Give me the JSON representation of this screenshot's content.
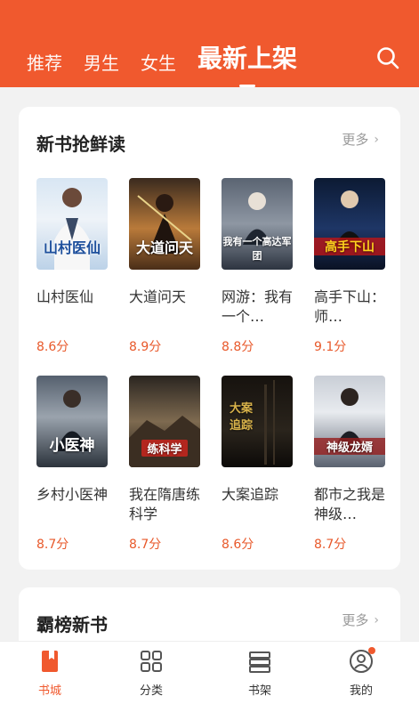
{
  "header": {
    "tabs": [
      {
        "label": "推荐"
      },
      {
        "label": "男生"
      },
      {
        "label": "女生"
      },
      {
        "label": "最新上架"
      }
    ],
    "active_tab": "最新上架",
    "search_icon": "search-icon",
    "bg_color": "#f0592e"
  },
  "section1": {
    "title": "新书抢鲜读",
    "more": "更多",
    "books": [
      {
        "title": "山村医仙",
        "score": "8.6分",
        "cover_text": "山村医仙"
      },
      {
        "title": "大道问天",
        "score": "8.9分",
        "cover_text": "大道问天"
      },
      {
        "title": "网游：我有一个…",
        "score": "8.8分",
        "cover_text": "我有一个高达军团"
      },
      {
        "title": "高手下山：师…",
        "score": "9.1分",
        "cover_text": "高手下山"
      },
      {
        "title": "乡村小医神",
        "score": "8.7分",
        "cover_text": "小医神"
      },
      {
        "title": "我在隋唐练科学",
        "score": "8.7分",
        "cover_text": "练科学"
      },
      {
        "title": "大案追踪",
        "score": "8.6分",
        "cover_text": "大案追踪"
      },
      {
        "title": "都市之我是神级…",
        "score": "8.7分",
        "cover_text": "神级龙婿"
      }
    ]
  },
  "section2": {
    "title": "霸榜新书",
    "more": "更多"
  },
  "bottom_nav": [
    {
      "label": "书城",
      "icon": "bookmark-book-icon"
    },
    {
      "label": "分类",
      "icon": "grid-icon"
    },
    {
      "label": "书架",
      "icon": "bookshelf-icon"
    },
    {
      "label": "我的",
      "icon": "user-icon"
    }
  ],
  "accent_color": "#f0592e",
  "score_color": "#e8592b"
}
